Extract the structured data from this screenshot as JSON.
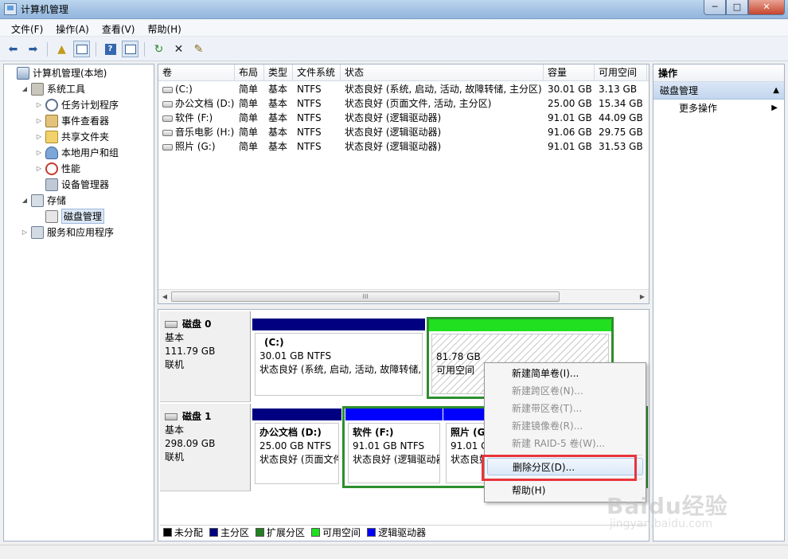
{
  "window": {
    "title": "计算机管理"
  },
  "window_buttons": {
    "minimize": "─",
    "maximize": "□",
    "close": "✕"
  },
  "menu": [
    "文件(F)",
    "操作(A)",
    "查看(V)",
    "帮助(H)"
  ],
  "tree": {
    "items": [
      {
        "label": "计算机管理(本地)",
        "icon": "computer-icon",
        "twisty": "",
        "level": 0
      },
      {
        "label": "系统工具",
        "icon": "tools-icon",
        "twisty": "◢",
        "level": 1
      },
      {
        "label": "任务计划程序",
        "icon": "clock-icon",
        "twisty": "▷",
        "level": 2
      },
      {
        "label": "事件查看器",
        "icon": "event-viewer-icon",
        "twisty": "▷",
        "level": 2
      },
      {
        "label": "共享文件夹",
        "icon": "shared-folder-icon",
        "twisty": "▷",
        "level": 2
      },
      {
        "label": "本地用户和组",
        "icon": "users-icon",
        "twisty": "▷",
        "level": 2
      },
      {
        "label": "性能",
        "icon": "performance-icon",
        "twisty": "▷",
        "level": 2
      },
      {
        "label": "设备管理器",
        "icon": "device-manager-icon",
        "twisty": "",
        "level": 2
      },
      {
        "label": "存储",
        "icon": "storage-icon",
        "twisty": "◢",
        "level": 1
      },
      {
        "label": "磁盘管理",
        "icon": "disk-icon",
        "twisty": "",
        "level": 2,
        "selected": true
      },
      {
        "label": "服务和应用程序",
        "icon": "services-icon",
        "twisty": "▷",
        "level": 1
      }
    ]
  },
  "volume_list": {
    "columns": [
      "卷",
      "布局",
      "类型",
      "文件系统",
      "状态",
      "容量",
      "可用空间"
    ],
    "rows": [
      [
        "(C:)",
        "简单",
        "基本",
        "NTFS",
        "状态良好 (系统, 启动, 活动, 故障转储, 主分区)",
        "30.01 GB",
        "3.13 GB"
      ],
      [
        "办公文档 (D:)",
        "简单",
        "基本",
        "NTFS",
        "状态良好 (页面文件, 活动, 主分区)",
        "25.00 GB",
        "15.34 GB"
      ],
      [
        "软件 (F:)",
        "简单",
        "基本",
        "NTFS",
        "状态良好 (逻辑驱动器)",
        "91.01 GB",
        "44.09 GB"
      ],
      [
        "音乐电影 (H:)",
        "简单",
        "基本",
        "NTFS",
        "状态良好 (逻辑驱动器)",
        "91.06 GB",
        "29.75 GB"
      ],
      [
        "照片 (G:)",
        "简单",
        "基本",
        "NTFS",
        "状态良好 (逻辑驱动器)",
        "91.01 GB",
        "31.53 GB"
      ]
    ],
    "scroll_grip": "III"
  },
  "disks": [
    {
      "name": "磁盘 0",
      "type": "基本",
      "size": "111.79 GB",
      "status": "联机",
      "partitions": [
        {
          "title": "(C:)",
          "size": "30.01 GB NTFS",
          "status": "状态良好 (系统, 启动, 活动, 故障转储,"
        },
        {
          "title": "",
          "size": "81.78 GB",
          "status": "可用空间"
        }
      ]
    },
    {
      "name": "磁盘 1",
      "type": "基本",
      "size": "298.09 GB",
      "status": "联机",
      "partitions": [
        {
          "title": "办公文档 (D:)",
          "size": "25.00 GB NTFS",
          "status": "状态良好 (页面文件"
        },
        {
          "title": "软件 (F:)",
          "size": "91.01 GB NTFS",
          "status": "状态良好 (逻辑驱动器"
        },
        {
          "title": "照片 (G",
          "size": "91.01 G",
          "status": "状态良好"
        }
      ]
    }
  ],
  "legend": [
    {
      "label": "未分配",
      "color": "#000000"
    },
    {
      "label": "主分区",
      "color": "#000080"
    },
    {
      "label": "扩展分区",
      "color": "#218021"
    },
    {
      "label": "可用空间",
      "color": "#20e020"
    },
    {
      "label": "逻辑驱动器",
      "color": "#0000ff"
    }
  ],
  "actions": {
    "header": "操作",
    "section": "磁盘管理",
    "section_caret": "▲",
    "items": [
      {
        "label": "更多操作",
        "caret": "▶"
      }
    ]
  },
  "context_menu": {
    "items": [
      {
        "label": "新建简单卷(I)...",
        "disabled": false
      },
      {
        "label": "新建跨区卷(N)...",
        "disabled": true
      },
      {
        "label": "新建带区卷(T)...",
        "disabled": true
      },
      {
        "label": "新建镜像卷(R)...",
        "disabled": true
      },
      {
        "label": "新建 RAID-5 卷(W)...",
        "disabled": true
      },
      {
        "label": "删除分区(D)...",
        "disabled": false,
        "highlighted": true
      },
      {
        "label": "帮助(H)",
        "disabled": false
      }
    ]
  },
  "watermark": {
    "brand": "Baidu经验",
    "sub": "jingyan.baidu.com"
  },
  "colors": {
    "primary_partition": "#000080",
    "logical_drive": "#0000ff",
    "free_space": "#20e020",
    "extended_partition": "#218021",
    "highlight": "#e8353b"
  }
}
